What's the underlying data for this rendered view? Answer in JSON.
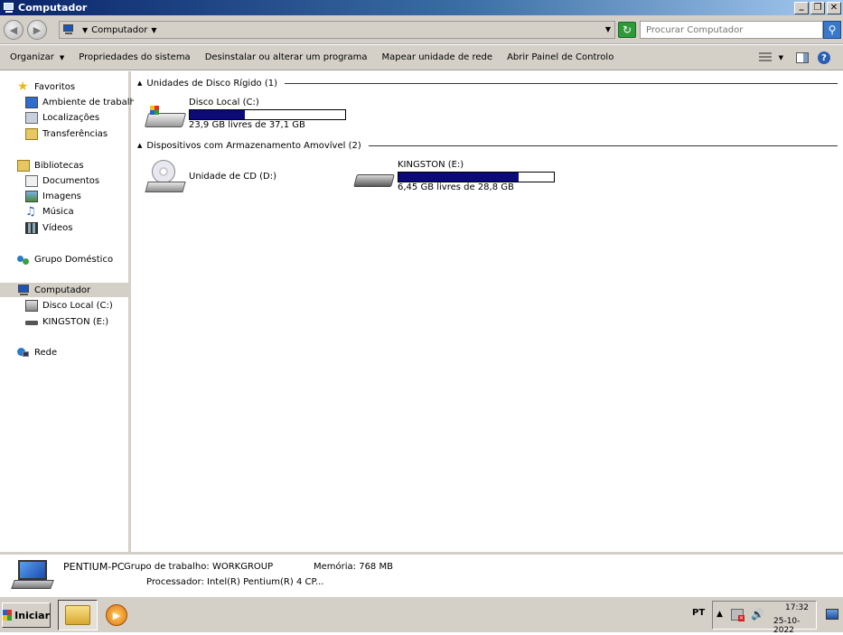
{
  "window": {
    "title": "Computador",
    "minimize": "_",
    "maximize": "❐",
    "close": "✕"
  },
  "nav": {
    "address_segment": "Computador",
    "search_placeholder": "Procurar Computador"
  },
  "toolbar": {
    "items": [
      "Organizar",
      "Propriedades do sistema",
      "Desinstalar ou alterar um programa",
      "Mapear unidade de rede",
      "Abrir Painel de Controlo"
    ]
  },
  "sidebar": {
    "favorites": {
      "label": "Favoritos",
      "items": [
        "Ambiente de trabalho",
        "Localizações",
        "Transferências"
      ]
    },
    "libraries": {
      "label": "Bibliotecas",
      "items": [
        "Documentos",
        "Imagens",
        "Música",
        "Vídeos"
      ]
    },
    "homegroup": "Grupo Doméstico",
    "computer": {
      "label": "Computador",
      "items": [
        "Disco Local (C:)",
        "KINGSTON (E:)"
      ]
    },
    "network": "Rede"
  },
  "content": {
    "hdd_group": "Unidades de Disco Rígido (1)",
    "removable_group": "Dispositivos com Armazenamento Amovível (2)",
    "drives": {
      "c": {
        "name": "Disco Local (C:)",
        "info": "23,9 GB livres de 37,1 GB",
        "used_fraction": 0.356
      },
      "d": {
        "name": "Unidade de CD (D:)"
      },
      "e": {
        "name": "KINGSTON (E:)",
        "info": "6,45 GB livres de 28,8 GB",
        "used_fraction": 0.776
      }
    }
  },
  "details": {
    "pc_name": "PENTIUM-PC",
    "workgroup": "Grupo de trabalho: WORKGROUP",
    "memory": "Memória: 768 MB",
    "processor": "Processador: Intel(R) Pentium(R) 4 CP..."
  },
  "taskbar": {
    "start": "Iniciar",
    "lang": "PT",
    "time": "17:32",
    "date": "25-10-2022"
  },
  "colors": {
    "usage_bar": "#0a0a78",
    "title_bar": "#0a246a"
  }
}
